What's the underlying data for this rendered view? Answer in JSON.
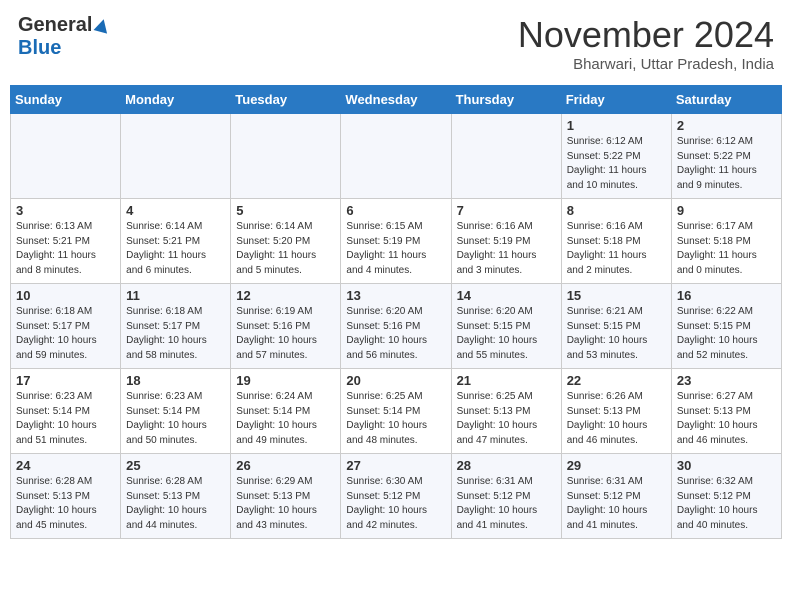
{
  "header": {
    "logo_general": "General",
    "logo_blue": "Blue",
    "month_title": "November 2024",
    "location": "Bharwari, Uttar Pradesh, India"
  },
  "calendar": {
    "days_of_week": [
      "Sunday",
      "Monday",
      "Tuesday",
      "Wednesday",
      "Thursday",
      "Friday",
      "Saturday"
    ],
    "weeks": [
      [
        {
          "day": "",
          "info": ""
        },
        {
          "day": "",
          "info": ""
        },
        {
          "day": "",
          "info": ""
        },
        {
          "day": "",
          "info": ""
        },
        {
          "day": "",
          "info": ""
        },
        {
          "day": "1",
          "info": "Sunrise: 6:12 AM\nSunset: 5:22 PM\nDaylight: 11 hours\nand 10 minutes."
        },
        {
          "day": "2",
          "info": "Sunrise: 6:12 AM\nSunset: 5:22 PM\nDaylight: 11 hours\nand 9 minutes."
        }
      ],
      [
        {
          "day": "3",
          "info": "Sunrise: 6:13 AM\nSunset: 5:21 PM\nDaylight: 11 hours\nand 8 minutes."
        },
        {
          "day": "4",
          "info": "Sunrise: 6:14 AM\nSunset: 5:21 PM\nDaylight: 11 hours\nand 6 minutes."
        },
        {
          "day": "5",
          "info": "Sunrise: 6:14 AM\nSunset: 5:20 PM\nDaylight: 11 hours\nand 5 minutes."
        },
        {
          "day": "6",
          "info": "Sunrise: 6:15 AM\nSunset: 5:19 PM\nDaylight: 11 hours\nand 4 minutes."
        },
        {
          "day": "7",
          "info": "Sunrise: 6:16 AM\nSunset: 5:19 PM\nDaylight: 11 hours\nand 3 minutes."
        },
        {
          "day": "8",
          "info": "Sunrise: 6:16 AM\nSunset: 5:18 PM\nDaylight: 11 hours\nand 2 minutes."
        },
        {
          "day": "9",
          "info": "Sunrise: 6:17 AM\nSunset: 5:18 PM\nDaylight: 11 hours\nand 0 minutes."
        }
      ],
      [
        {
          "day": "10",
          "info": "Sunrise: 6:18 AM\nSunset: 5:17 PM\nDaylight: 10 hours\nand 59 minutes."
        },
        {
          "day": "11",
          "info": "Sunrise: 6:18 AM\nSunset: 5:17 PM\nDaylight: 10 hours\nand 58 minutes."
        },
        {
          "day": "12",
          "info": "Sunrise: 6:19 AM\nSunset: 5:16 PM\nDaylight: 10 hours\nand 57 minutes."
        },
        {
          "day": "13",
          "info": "Sunrise: 6:20 AM\nSunset: 5:16 PM\nDaylight: 10 hours\nand 56 minutes."
        },
        {
          "day": "14",
          "info": "Sunrise: 6:20 AM\nSunset: 5:15 PM\nDaylight: 10 hours\nand 55 minutes."
        },
        {
          "day": "15",
          "info": "Sunrise: 6:21 AM\nSunset: 5:15 PM\nDaylight: 10 hours\nand 53 minutes."
        },
        {
          "day": "16",
          "info": "Sunrise: 6:22 AM\nSunset: 5:15 PM\nDaylight: 10 hours\nand 52 minutes."
        }
      ],
      [
        {
          "day": "17",
          "info": "Sunrise: 6:23 AM\nSunset: 5:14 PM\nDaylight: 10 hours\nand 51 minutes."
        },
        {
          "day": "18",
          "info": "Sunrise: 6:23 AM\nSunset: 5:14 PM\nDaylight: 10 hours\nand 50 minutes."
        },
        {
          "day": "19",
          "info": "Sunrise: 6:24 AM\nSunset: 5:14 PM\nDaylight: 10 hours\nand 49 minutes."
        },
        {
          "day": "20",
          "info": "Sunrise: 6:25 AM\nSunset: 5:14 PM\nDaylight: 10 hours\nand 48 minutes."
        },
        {
          "day": "21",
          "info": "Sunrise: 6:25 AM\nSunset: 5:13 PM\nDaylight: 10 hours\nand 47 minutes."
        },
        {
          "day": "22",
          "info": "Sunrise: 6:26 AM\nSunset: 5:13 PM\nDaylight: 10 hours\nand 46 minutes."
        },
        {
          "day": "23",
          "info": "Sunrise: 6:27 AM\nSunset: 5:13 PM\nDaylight: 10 hours\nand 46 minutes."
        }
      ],
      [
        {
          "day": "24",
          "info": "Sunrise: 6:28 AM\nSunset: 5:13 PM\nDaylight: 10 hours\nand 45 minutes."
        },
        {
          "day": "25",
          "info": "Sunrise: 6:28 AM\nSunset: 5:13 PM\nDaylight: 10 hours\nand 44 minutes."
        },
        {
          "day": "26",
          "info": "Sunrise: 6:29 AM\nSunset: 5:13 PM\nDaylight: 10 hours\nand 43 minutes."
        },
        {
          "day": "27",
          "info": "Sunrise: 6:30 AM\nSunset: 5:12 PM\nDaylight: 10 hours\nand 42 minutes."
        },
        {
          "day": "28",
          "info": "Sunrise: 6:31 AM\nSunset: 5:12 PM\nDaylight: 10 hours\nand 41 minutes."
        },
        {
          "day": "29",
          "info": "Sunrise: 6:31 AM\nSunset: 5:12 PM\nDaylight: 10 hours\nand 41 minutes."
        },
        {
          "day": "30",
          "info": "Sunrise: 6:32 AM\nSunset: 5:12 PM\nDaylight: 10 hours\nand 40 minutes."
        }
      ]
    ]
  }
}
